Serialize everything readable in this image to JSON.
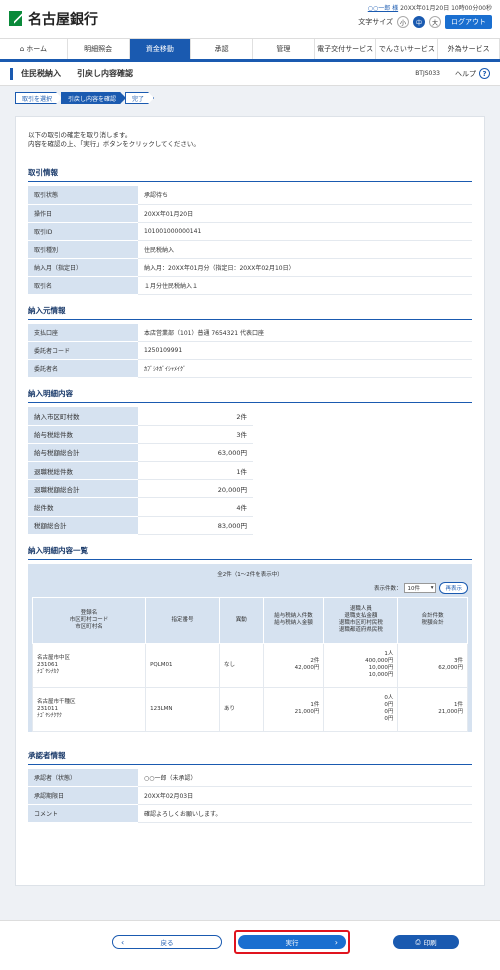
{
  "header": {
    "bank_name": "名古屋銀行",
    "user_name": "○○一郎 様",
    "last_login": "20XX年01月20日 10時00分00秒",
    "font_size_label": "文字サイズ",
    "font_sizes": [
      "小",
      "中",
      "大"
    ],
    "logout_label": "ログアウト"
  },
  "nav": {
    "items": [
      "ホーム",
      "明細照会",
      "資金移動",
      "承認",
      "管理",
      "電子交付サービス",
      "でんさいサービス",
      "外為サービス"
    ]
  },
  "page": {
    "title": "住民税納入",
    "subtitle": "引戻し内容確認",
    "page_id": "BTJS033",
    "help_label": "ヘルプ",
    "help_icon": "?"
  },
  "steps": [
    "取引を選択",
    "引戻し内容を確認",
    "完了"
  ],
  "intro": {
    "line1": "以下の取引の確定を取り消します。",
    "line2": "内容を確認の上、「実行」ボタンをクリックしてください。"
  },
  "transaction_info": {
    "title": "取引情報",
    "rows": [
      {
        "label": "取引状態",
        "value": "承認待ち"
      },
      {
        "label": "操作日",
        "value": "20XX年01月20日"
      },
      {
        "label": "取引ID",
        "value": "101001000000141"
      },
      {
        "label": "取引種別",
        "value": "住民税納入"
      },
      {
        "label": "納入月（指定日）",
        "value": "納入月：20XX年01月分（指定日：20XX年02月10日）"
      },
      {
        "label": "取引名",
        "value": "１月分住民税納入１"
      }
    ]
  },
  "payer_info": {
    "title": "納入元情報",
    "rows": [
      {
        "label": "支払口座",
        "value": "本店営業部（101）普通 7654321 代表口座"
      },
      {
        "label": "委託者コード",
        "value": "1250109991"
      },
      {
        "label": "委託者名",
        "value": "ｶﾌﾞｼｷｶﾞｲｼｬﾒｲｸﾞ"
      }
    ]
  },
  "payment_summary": {
    "title": "納入明細内容",
    "rows": [
      {
        "label": "納入市区町村数",
        "value": "2件"
      },
      {
        "label": "給与税総件数",
        "value": "3件"
      },
      {
        "label": "給与税額総合計",
        "value": "63,000円"
      },
      {
        "label": "退職税総件数",
        "value": "1件"
      },
      {
        "label": "退職税額総合計",
        "value": "20,000円"
      },
      {
        "label": "総件数",
        "value": "4件"
      },
      {
        "label": "税額総合計",
        "value": "83,000円"
      }
    ]
  },
  "payment_list": {
    "title": "納入明細内容一覧",
    "count_text": "全2件（1～2件を表示中）",
    "display_count_label": "表示件数：",
    "display_count_value": "10件",
    "redisplay_label": "再表示",
    "headers": [
      [
        "登録名",
        "市区町村コード",
        "市区町村名"
      ],
      [
        "指定番号"
      ],
      [
        "異動"
      ],
      [
        "給与税納入件数",
        "給与税納入金額"
      ],
      [
        "退職人員",
        "退職支払金額",
        "退職市区町村民税",
        "退職都道府県民税"
      ],
      [
        "合計件数",
        "税額合計"
      ]
    ],
    "rows": [
      {
        "name": [
          "名古屋市中区",
          "231061",
          "ﾅｺﾞﾔｼﾅｶｸ"
        ],
        "designation": "PQLM01",
        "change": "なし",
        "salary": [
          "2件",
          "42,000円"
        ],
        "retire": [
          "1人",
          "400,000円",
          "10,000円",
          "10,000円"
        ],
        "total": [
          "3件",
          "62,000円"
        ]
      },
      {
        "name": [
          "名古屋市千種区",
          "231011",
          "ﾅｺﾞﾔｼﾁｸｻｸ"
        ],
        "designation": "123LMN",
        "change": "あり",
        "salary": [
          "1件",
          "21,000円"
        ],
        "retire": [
          "0人",
          "0円",
          "0円",
          "0円"
        ],
        "total": [
          "1件",
          "21,000円"
        ]
      }
    ]
  },
  "approver_info": {
    "title": "承認者情報",
    "rows": [
      {
        "label": "承認者（状態）",
        "value": "○○一郎（未承認）"
      },
      {
        "label": "承認期限日",
        "value": "20XX年02月03日"
      },
      {
        "label": "コメント",
        "value": "確認よろしくお願いします。"
      }
    ]
  },
  "footer": {
    "back_label": "戻る",
    "execute_label": "実行",
    "print_label": "印刷"
  }
}
